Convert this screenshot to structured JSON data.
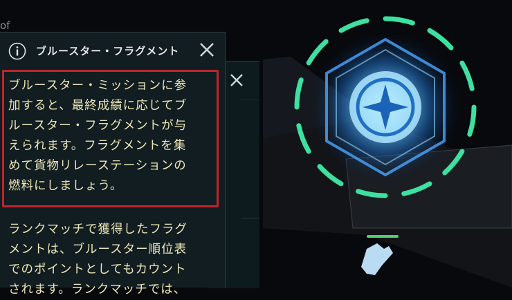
{
  "background": {
    "partial_text": "of"
  },
  "tooltip": {
    "title": "ブルースター・フラグメント",
    "paragraph1": [
      "ブルースター・ミッションに参",
      "加すると、最終成績に応じてブ",
      "ルースター・フラグメントが与",
      "えられます。フラグメントを集",
      "めて貨物リレーステーションの",
      "燃料にしましょう。"
    ],
    "paragraph2": [
      "ランクマッチで獲得したフラグ",
      "メントは、ブルースター順位表",
      "でのポイントとしてもカウント",
      "されます。ランクマッチでは、"
    ]
  },
  "icons": {
    "info": "info-icon",
    "close": "close-icon",
    "emblem": "blue-star-emblem-icon",
    "cargo": "cargo-ship-icon"
  },
  "colors": {
    "highlight_border": "#c0242b",
    "body_text": "#ece6b8",
    "emblem_ring": "#3ee0a0",
    "emblem_core": "#3fb6ff",
    "indicator": "#4ecd73"
  }
}
